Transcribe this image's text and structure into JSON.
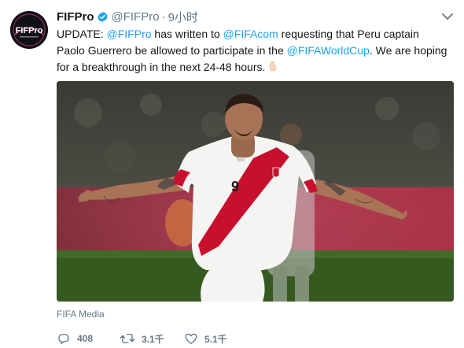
{
  "tweet": {
    "author": {
      "name": "FIFPro",
      "handle": "@FIFPro",
      "time": "9小时",
      "separator": "·",
      "avatar_text": "FIFPro"
    },
    "text": {
      "t1": "UPDATE: ",
      "m1": "@FIFPro",
      "t2": " has written to ",
      "m2": "@FIFAcom",
      "t3": " requesting that Peru captain Paolo Guerrero be allowed to participate in the ",
      "m3": "@FIFAWorldCup",
      "t4": ". We are hoping for a breakthrough in the next 24-48 hours."
    },
    "media": {
      "credit": "FIFA Media",
      "jersey_number": "9"
    },
    "actions": {
      "replies": "408",
      "retweets": "3.1千",
      "likes": "5.1千"
    }
  },
  "colors": {
    "link": "#1da1f2",
    "secondary_text": "#657786",
    "verified_badge": "#1da1f2"
  },
  "icons": [
    "verified-badge-icon",
    "caret-down-icon",
    "crossed-fingers-emoji-icon",
    "reply-icon",
    "retweet-icon",
    "like-icon"
  ]
}
